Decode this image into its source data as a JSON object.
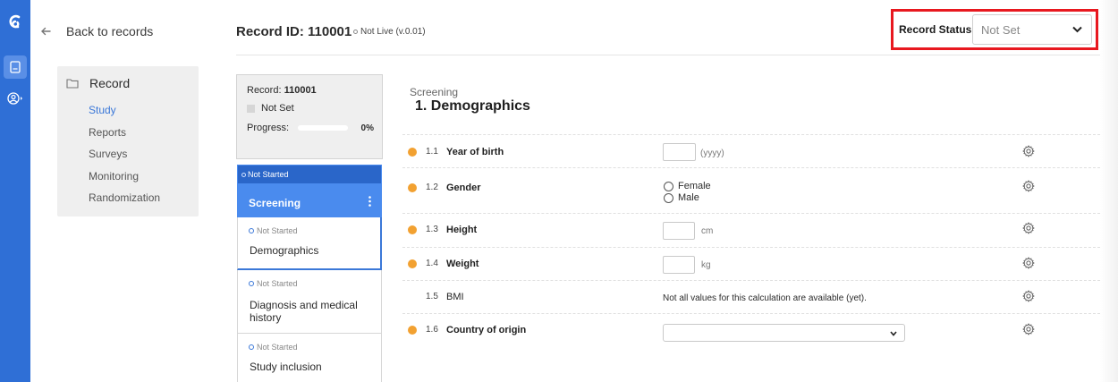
{
  "nav": {
    "back_label": "Back to records",
    "section_label": "Record",
    "items": [
      {
        "label": "Study",
        "active": true
      },
      {
        "label": "Reports",
        "active": false
      },
      {
        "label": "Surveys",
        "active": false
      },
      {
        "label": "Monitoring",
        "active": false
      },
      {
        "label": "Randomization",
        "active": false
      }
    ]
  },
  "header": {
    "record_id": "Record ID: 110001",
    "live_status": "Not Live (v.0.01)",
    "status_label": "Record Status:",
    "status_value": "Not Set"
  },
  "summary": {
    "record_prefix": "Record: ",
    "record_number": "110001",
    "status": "Not Set",
    "progress_label": "Progress:",
    "progress_value": "0%"
  },
  "phase": {
    "status": "Not Started",
    "name": "Screening"
  },
  "steps": [
    {
      "status": "Not Started",
      "name": "Demographics",
      "selected": true
    },
    {
      "status": "Not Started",
      "name": "Diagnosis and medical history",
      "selected": false
    },
    {
      "status": "Not Started",
      "name": "Study inclusion",
      "selected": false
    }
  ],
  "form": {
    "breadcrumb": "Screening",
    "title": "1. Demographics",
    "fields": [
      {
        "num": "1.1",
        "label": "Year of birth",
        "unit": "(yyyy)"
      },
      {
        "num": "1.2",
        "label": "Gender",
        "options": [
          "Female",
          "Male"
        ]
      },
      {
        "num": "1.3",
        "label": "Height",
        "unit": "cm"
      },
      {
        "num": "1.4",
        "label": "Weight",
        "unit": "kg"
      },
      {
        "num": "1.5",
        "label": "BMI",
        "note": "Not all values for this calculation are available (yet)."
      },
      {
        "num": "1.6",
        "label": "Country of origin",
        "value": ""
      }
    ]
  },
  "colors": {
    "rail": "#2f6fd6",
    "accent": "#3b78d8",
    "phase_card": "#4a8bee",
    "phase_header": "#2a66c9",
    "required_bullet": "#f2a131",
    "status_highlight": "#e8181f"
  }
}
